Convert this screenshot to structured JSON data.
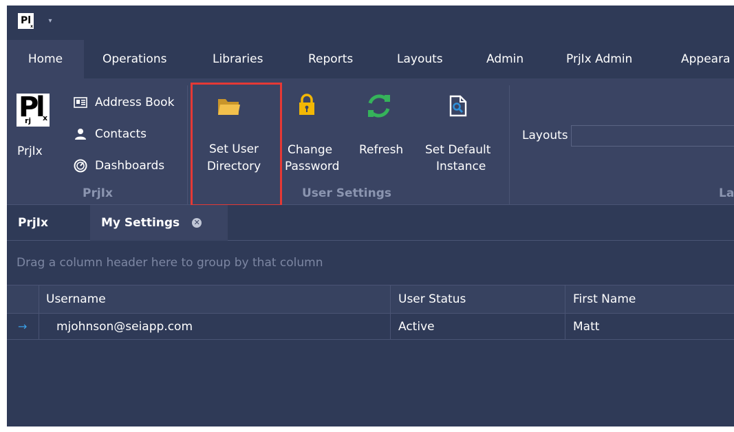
{
  "title_bar": {
    "logo_text": "Pl",
    "logo_sub": "x",
    "qat_dropdown_glyph": "▾"
  },
  "ribbon": {
    "tabs": [
      {
        "label": "Home",
        "active": true
      },
      {
        "label": "Operations"
      },
      {
        "label": "Libraries"
      },
      {
        "label": "Reports"
      },
      {
        "label": "Layouts"
      },
      {
        "label": "Admin"
      },
      {
        "label": "PrjIx Admin"
      },
      {
        "label": "Appeara"
      }
    ],
    "groups": {
      "prjix": {
        "label": "PrjIx",
        "big_button_label": "PrjIx",
        "logo": {
          "P": "P",
          "l": "l",
          "rj": "rj",
          "x": "x"
        },
        "small_buttons": [
          {
            "label": "Address Book",
            "icon": "address-book-icon"
          },
          {
            "label": "Contacts",
            "icon": "contacts-icon"
          },
          {
            "label": "Dashboards",
            "icon": "dashboard-icon"
          }
        ]
      },
      "user_settings": {
        "label": "User Settings",
        "buttons": [
          {
            "line1": "Set User",
            "line2": "Directory",
            "icon": "folder-icon"
          },
          {
            "line1": "Change",
            "line2": "Password",
            "icon": "lock-icon"
          },
          {
            "line1": "Refresh",
            "line2": "",
            "icon": "refresh-icon"
          },
          {
            "line1": "Set Default",
            "line2": "Instance",
            "icon": "document-search-icon"
          }
        ]
      },
      "layouts": {
        "label": "La",
        "field_label": "Layouts",
        "field_value": ""
      }
    }
  },
  "doc_tabs": [
    {
      "label": "PrjIx",
      "active": false
    },
    {
      "label": "My Settings",
      "active": true,
      "closable": true
    }
  ],
  "grid": {
    "group_panel_text": "Drag a column header here to group by that column",
    "columns": [
      "Username",
      "User Status",
      "First Name"
    ],
    "rows": [
      {
        "indicator": "→",
        "cells": [
          "mjohnson@seiapp.com",
          "Active",
          "Matt"
        ]
      }
    ]
  },
  "colors": {
    "background": "#2f3a57",
    "ribbon": "#3a4463",
    "highlight": "#e53935",
    "group_label": "#8b95b0",
    "folder": "#f2c04c",
    "lock": "#f2b705",
    "refresh": "#35b35a"
  }
}
